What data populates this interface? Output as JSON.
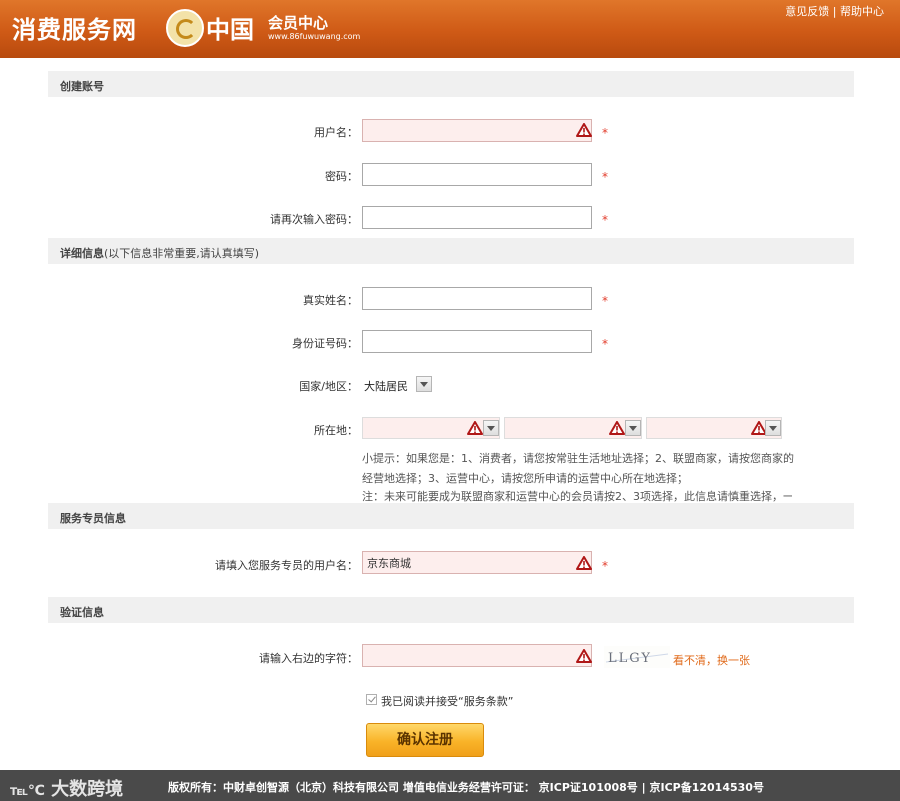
{
  "header": {
    "logo_text": "消费服务网",
    "logo_cn": "中国",
    "logo_sub": "会员中心",
    "logo_url": "www.86fuwuwang.com",
    "feedback": "意见反馈",
    "separator": "|",
    "help": "帮助中心"
  },
  "sections": {
    "account": "创建账号",
    "details": "详细信息",
    "details_note": "(以下信息非常重要,请认真填写)",
    "service": "服务专员信息",
    "verify": "验证信息"
  },
  "fields": {
    "username_label": "用户名：",
    "password_label": "密码：",
    "password2_label": "请再次输入密码：",
    "realname_label": "真实姓名：",
    "idcard_label": "身份证号码：",
    "country_label": "国家/地区：",
    "country_value": "大陆居民",
    "location_label": "所在地：",
    "service_label": "请填入您服务专员的用户名：",
    "service_value": "京东商城",
    "captcha_label": "请输入右边的字符：",
    "required_mark": "*"
  },
  "tips": {
    "line1": "小提示：如果您是：1、消费者，请您按常驻生活地址选择；2、联盟商家，请按您商家的",
    "line2": "经营地选择；3、运营中心，请按您所申请的运营中心所在地选择；",
    "line3": "注：未来可能要成为联盟商家和运营中心的会员请按2、3项选择，此信息请慎重选择，一"
  },
  "captcha": {
    "code": "LLGY",
    "refresh": "看不清，换一张"
  },
  "agreement": {
    "text": "我已阅读并接受“服务条款”"
  },
  "submit": {
    "label": "确认注册"
  },
  "footer": {
    "watermark": "大数跨境",
    "text": "版权所有：中财卓创智源（北京）科技有限公司 增值电信业务经营许可证： 京ICP证101008号 | 京ICP备12014530号"
  },
  "colors": {
    "header": "#cf5a16",
    "error_bg": "#fdeeed",
    "required": "#e23c2b",
    "submit": "#f9b328",
    "footer": "#4a4a4a"
  }
}
